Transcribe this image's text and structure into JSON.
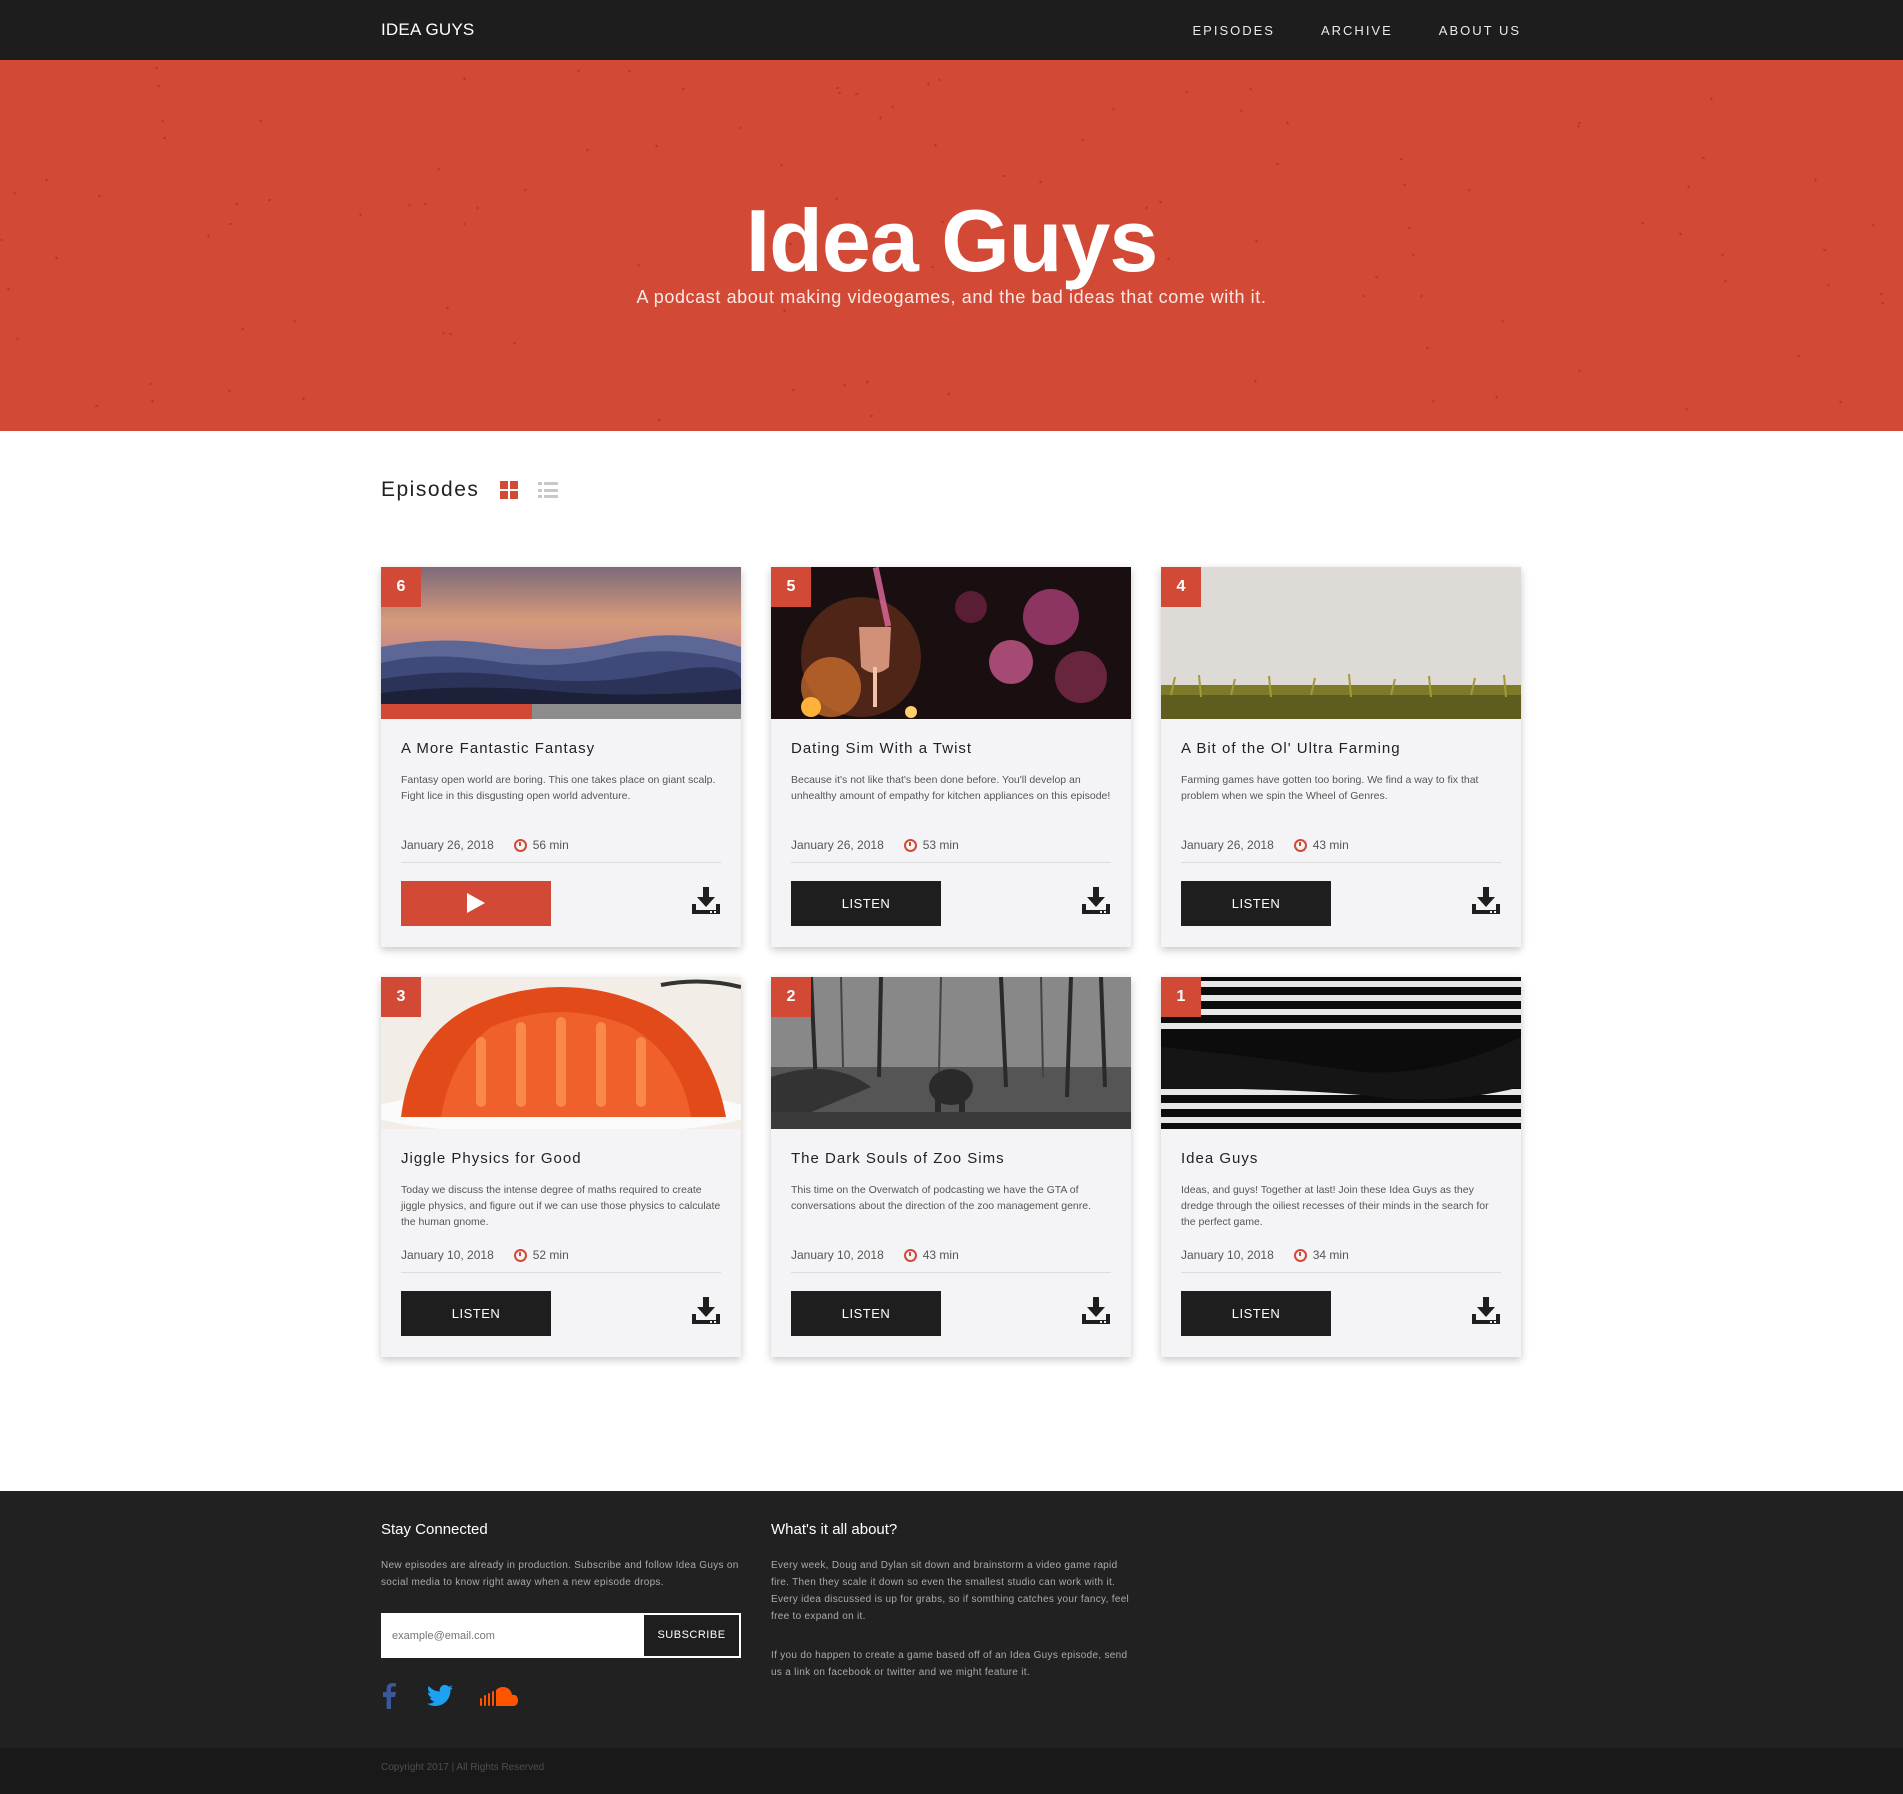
{
  "nav": {
    "brand": "IDEA GUYS",
    "links": [
      "EPISODES",
      "ARCHIVE",
      "ABOUT US"
    ]
  },
  "hero": {
    "title": "Idea Guys",
    "subtitle": "A podcast about making videogames, and the bad ideas that come with it."
  },
  "episodes_section": {
    "title": "Episodes",
    "view_grid_icon": "grid-view-icon",
    "view_list_icon": "list-view-icon"
  },
  "episodes": [
    {
      "number": "6",
      "title": "A More Fantastic Fantasy",
      "description": "Fantasy open world are boring. This one takes place on giant scalp. Fight lice in this disgusting open world adventure.",
      "date": "January 26, 2018",
      "duration": "56 min",
      "button": "",
      "playing": true,
      "progress": 0.42
    },
    {
      "number": "5",
      "title": "Dating Sim With a Twist",
      "description": "Because it's not like that's been done before. You'll develop an unhealthy amount of empathy for kitchen appliances on this episode!",
      "date": "January 26, 2018",
      "duration": "53 min",
      "button": "LISTEN",
      "playing": false
    },
    {
      "number": "4",
      "title": "A Bit of the Ol' Ultra Farming",
      "description": "Farming games have gotten too boring. We find a way to fix that problem when we spin the Wheel of Genres.",
      "date": "January 26, 2018",
      "duration": "43 min",
      "button": "LISTEN",
      "playing": false
    },
    {
      "number": "3",
      "title": "Jiggle Physics for Good",
      "description": "Today we discuss the intense degree of maths required to create jiggle physics, and figure out if we can use those physics to calculate the human gnome.",
      "date": "January 10, 2018",
      "duration": "52 min",
      "button": "LISTEN",
      "playing": false
    },
    {
      "number": "2",
      "title": "The Dark Souls of Zoo Sims",
      "description": "This time on the Overwatch of podcasting we have the GTA of conversations about the direction of the zoo management genre.",
      "date": "January 10, 2018",
      "duration": "43 min",
      "button": "LISTEN",
      "playing": false
    },
    {
      "number": "1",
      "title": "Idea Guys",
      "description": "Ideas, and guys! Together at last! Join these Idea Guys as they dredge through the oiliest recesses of their minds in the search for the perfect game.",
      "date": "January 10, 2018",
      "duration": "34 min",
      "button": "LISTEN",
      "playing": false
    }
  ],
  "footer": {
    "stay_connected": {
      "title": "Stay Connected",
      "text": "New episodes are already in production. Subscribe and follow Idea Guys on social media to know right away when a new episode drops.",
      "email_placeholder": "example@email.com",
      "subscribe_label": "SUBSCRIBE",
      "social_icons": [
        "facebook-icon",
        "twitter-icon",
        "soundcloud-icon"
      ]
    },
    "about": {
      "title": "What's it all about?",
      "paragraph1": "Every week, Doug and Dylan sit down and brainstorm a video game rapid fire. Then they scale it down so even the smallest studio can work with it. Every idea discussed is up for grabs, so if somthing catches your fancy, feel free to expand on it.",
      "paragraph2": "If you do happen to create a game based off of an Idea Guys episode, send us a link on facebook or twitter and we might feature it."
    },
    "copyright": "Copyright 2017 | All Rights Reserved"
  },
  "colors": {
    "accent": "#d24a36",
    "dark": "#1d1d1d",
    "card_bg": "#f4f4f6"
  }
}
